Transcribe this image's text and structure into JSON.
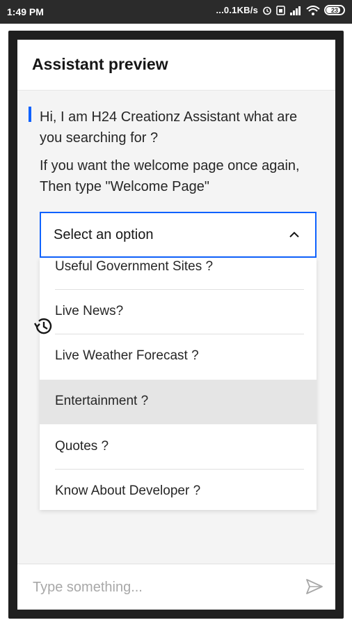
{
  "status_bar": {
    "time": "1:49 PM",
    "net_speed": "...0.1KB/s",
    "battery": "23",
    "icons": [
      "alarm-icon",
      "sim-icon",
      "signal-icon",
      "wifi-icon",
      "battery-icon"
    ]
  },
  "panel": {
    "title": "Assistant preview"
  },
  "messages": [
    "Hi, I am H24 Creationz Assistant what are you searching for ?",
    "If you want the welcome page once again, Then type \"Welcome Page\""
  ],
  "select": {
    "label": "Select an option",
    "options": [
      "Useful Government Sites ?",
      "Live News?",
      "Live Weather Forecast ?",
      "Entertainment ?",
      "Quotes ?",
      "Know About Developer ?"
    ],
    "highlighted_option": "Entertainment ?"
  },
  "input": {
    "placeholder": "Type something...",
    "value": ""
  },
  "colors": {
    "accent": "#0f62fe",
    "status_bar": "#2b2b2b",
    "highlight": "#e5e5e5"
  }
}
